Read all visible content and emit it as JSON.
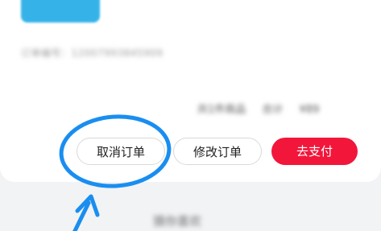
{
  "order_card": {
    "order_number_row": "订单编号：12007993845909",
    "summary": {
      "count": "共1件商品",
      "total_label": "合计",
      "amount": "¥89"
    }
  },
  "actions": {
    "cancel_label": "取消订单",
    "modify_label": "修改订单",
    "pay_label": "去支付"
  },
  "bottom_link": "猜你喜欢",
  "colors": {
    "pay_button": "#f2163b",
    "annotation": "#1a8ef0",
    "thumbnail": "#35b3e8"
  }
}
